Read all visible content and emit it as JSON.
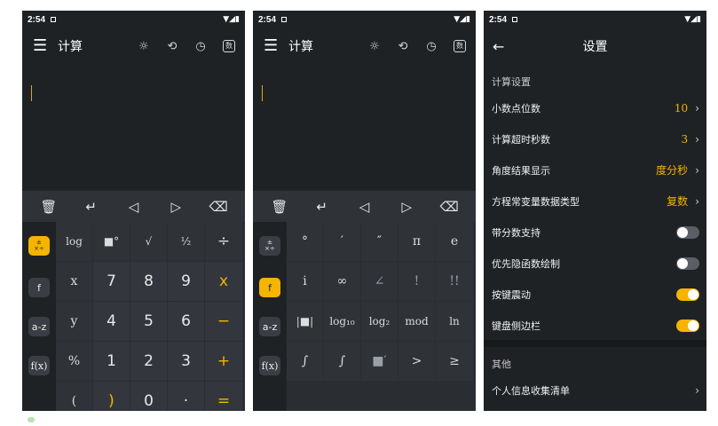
{
  "status": {
    "time": "2:54",
    "signal": "▼◢▮"
  },
  "calc": {
    "title": "计算",
    "mode_icon": "数",
    "toolbar": {
      "delete": "🗑",
      "enter": "↵",
      "left": "◁",
      "right": "▷",
      "backspace": "⌫"
    },
    "side": {
      "ops": "±\n×÷",
      "f": "f",
      "az": "a-z",
      "fx": "f(x)"
    },
    "page1": {
      "row1": [
        "log",
        "■°",
        "√",
        "½",
        "÷"
      ],
      "row2": [
        "x",
        "7",
        "8",
        "9",
        "x"
      ],
      "row3": [
        "y",
        "4",
        "5",
        "6",
        "−"
      ],
      "row4": [
        "%",
        "1",
        "2",
        "3",
        "+"
      ],
      "row5": [
        "(",
        ")",
        "0",
        "·",
        "="
      ]
    },
    "page2": {
      "row1": [
        "°",
        "′",
        "″",
        "π",
        "e"
      ],
      "row2": [
        "i",
        "∞",
        "∠",
        "!",
        "!!"
      ],
      "row3": [
        "|■|",
        "log₁₀",
        "log₂",
        "mod",
        "ln"
      ],
      "row4": [
        "∫",
        "∫",
        "■′",
        ">",
        "≥"
      ]
    }
  },
  "settings": {
    "title": "设置",
    "section_calc": "计算设置",
    "rows": [
      {
        "label": "小数点位数",
        "value": "10"
      },
      {
        "label": "计算超时秒数",
        "value": "3"
      },
      {
        "label": "角度结果显示",
        "value": "度分秒"
      },
      {
        "label": "方程常变量数据类型",
        "value": "复数"
      },
      {
        "label": "带分数支持",
        "toggle": false
      },
      {
        "label": "优先隐函数绘制",
        "toggle": false
      },
      {
        "label": "按键震动",
        "toggle": true
      },
      {
        "label": "键盘侧边栏",
        "toggle": true
      }
    ],
    "section_other": "其他",
    "privacy_row": "个人信息收集清单"
  },
  "colors": {
    "accent": "#f5b400",
    "background": "#1f2225",
    "keyboard": "#2a2e33"
  }
}
